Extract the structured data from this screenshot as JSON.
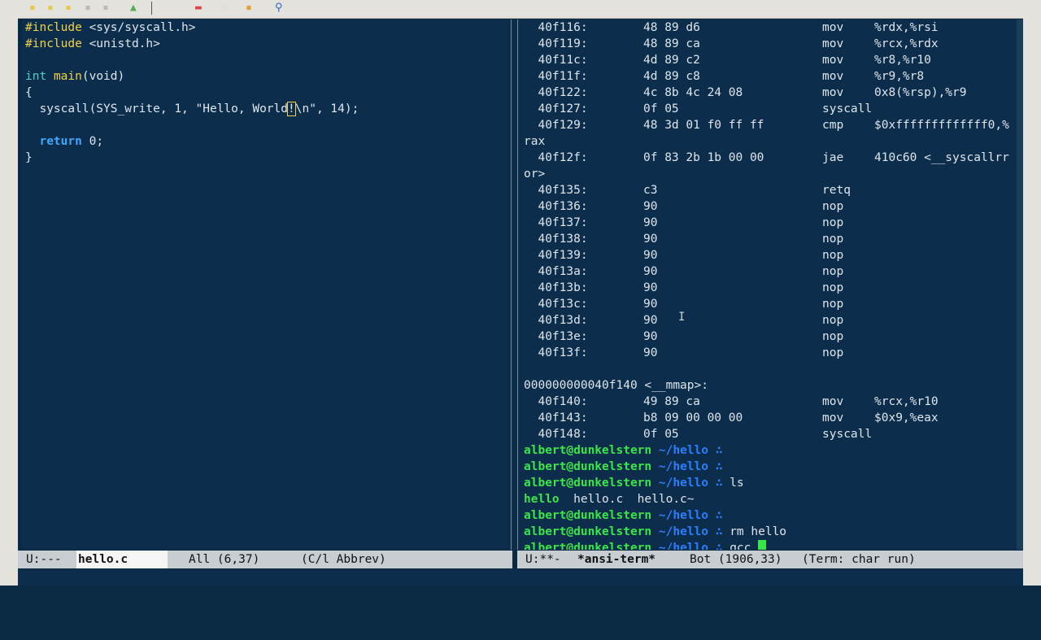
{
  "toolbar": {
    "icons": [
      "new-file-icon",
      "open-file-icon",
      "open-dir-icon",
      "close-icon",
      "save-icon",
      "undo-icon",
      "cut-icon",
      "copy-icon",
      "paste-icon",
      "search-icon"
    ]
  },
  "editor": {
    "lines": [
      {
        "pre": "#include",
        "rest": " <sys/syscall.h>"
      },
      {
        "pre": "#include",
        "rest": " <unistd.h>"
      }
    ],
    "main_type": "int",
    "main_name": "main",
    "main_args": "(void)",
    "brace_open": "{",
    "syscall_a": "  syscall(SYS_write, 1, \"Hello, World",
    "syscall_cursor": "!",
    "syscall_b": "\\n\", 14);",
    "return_kw": "return",
    "return_rest": " 0;",
    "brace_close": "}"
  },
  "disasm": [
    {
      "addr": "  40f116:",
      "bytes": "48 89 d6",
      "op": "mov",
      "arg": "%rdx,%rsi"
    },
    {
      "addr": "  40f119:",
      "bytes": "48 89 ca",
      "op": "mov",
      "arg": "%rcx,%rdx"
    },
    {
      "addr": "  40f11c:",
      "bytes": "4d 89 c2",
      "op": "mov",
      "arg": "%r8,%r10"
    },
    {
      "addr": "  40f11f:",
      "bytes": "4d 89 c8",
      "op": "mov",
      "arg": "%r9,%r8"
    },
    {
      "addr": "  40f122:",
      "bytes": "4c 8b 4c 24 08",
      "op": "mov",
      "arg": "0x8(%rsp),%r9"
    },
    {
      "addr": "  40f127:",
      "bytes": "0f 05",
      "op": "syscall",
      "arg": ""
    },
    {
      "addr": "  40f129:",
      "bytes": "48 3d 01 f0 ff ff",
      "op": "cmp",
      "arg": "$0xfffffffffffff0,%"
    },
    {
      "wrap": "rax"
    },
    {
      "addr": "  40f12f:",
      "bytes": "0f 83 2b 1b 00 00",
      "op": "jae",
      "arg": "410c60 <__syscallrr"
    },
    {
      "wrap": "or>"
    },
    {
      "addr": "  40f135:",
      "bytes": "c3",
      "op": "retq",
      "arg": ""
    },
    {
      "addr": "  40f136:",
      "bytes": "90",
      "op": "nop",
      "arg": ""
    },
    {
      "addr": "  40f137:",
      "bytes": "90",
      "op": "nop",
      "arg": ""
    },
    {
      "addr": "  40f138:",
      "bytes": "90",
      "op": "nop",
      "arg": ""
    },
    {
      "addr": "  40f139:",
      "bytes": "90",
      "op": "nop",
      "arg": ""
    },
    {
      "addr": "  40f13a:",
      "bytes": "90",
      "op": "nop",
      "arg": ""
    },
    {
      "addr": "  40f13b:",
      "bytes": "90",
      "op": "nop",
      "arg": ""
    },
    {
      "addr": "  40f13c:",
      "bytes": "90",
      "op": "nop",
      "arg": ""
    },
    {
      "addr": "  40f13d:",
      "bytes": "90",
      "op": "nop",
      "arg": ""
    },
    {
      "addr": "  40f13e:",
      "bytes": "90",
      "op": "nop",
      "arg": ""
    },
    {
      "addr": "  40f13f:",
      "bytes": "90",
      "op": "nop",
      "arg": ""
    },
    {
      "wrap": ""
    },
    {
      "wrap": "000000000040f140 <__mmap>:"
    },
    {
      "addr": "  40f140:",
      "bytes": "49 89 ca",
      "op": "mov",
      "arg": "%rcx,%r10"
    },
    {
      "addr": "  40f143:",
      "bytes": "b8 09 00 00 00",
      "op": "mov",
      "arg": "$0x9,%eax"
    },
    {
      "addr": "  40f148:",
      "bytes": "0f 05",
      "op": "syscall",
      "arg": ""
    }
  ],
  "shell": {
    "user": "albert@dunkelstern",
    "path": "~/hello",
    "symbol": "∴",
    "commands": [
      "",
      "",
      "ls",
      "",
      "rm hello",
      "gcc "
    ],
    "ls_output": {
      "exe": "hello",
      "files": "  hello.c  hello.c~"
    }
  },
  "modeline_left": {
    "status": "U:---",
    "buffer": "hello.c",
    "position": "All (6,37)",
    "mode": "(C/l Abbrev)"
  },
  "modeline_right": {
    "status": "U:**-",
    "buffer": "*ansi-term*",
    "position": "Bot (1906,33)",
    "mode": "(Term: char run)"
  },
  "colors": {
    "background": "#0c2d4b",
    "prompt": "#39e64a",
    "path": "#2a7fff",
    "preproc": "#f2d24a",
    "keyword": "#3fa7ff"
  }
}
